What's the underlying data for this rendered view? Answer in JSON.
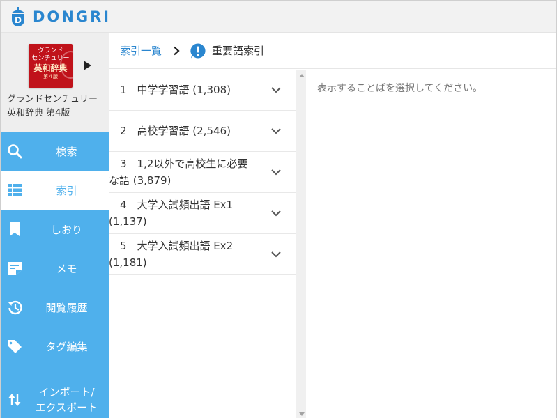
{
  "header": {
    "brand": "DONGRI",
    "logo_icon": "acorn-d-icon",
    "brand_color": "#2a86cf"
  },
  "book": {
    "cover_lines": [
      "グランド",
      "センチュリー",
      "英和辞典",
      "第４版"
    ],
    "title_line1": "グランドセンチュリー",
    "title_line2": "英和辞典 第4版",
    "cover_color": "#c0121a"
  },
  "sidebar": {
    "color": "#4fb0ec",
    "items": [
      {
        "label": "検索",
        "icon": "search-icon"
      },
      {
        "label": "索引",
        "icon": "grid-icon",
        "active": true
      },
      {
        "label": "しおり",
        "icon": "bookmark-icon"
      },
      {
        "label": "メモ",
        "icon": "note-icon"
      },
      {
        "label": "閲覧履歴",
        "icon": "history-icon"
      },
      {
        "label": "タグ編集",
        "icon": "tag-icon"
      },
      {
        "label_line1": "インポート/",
        "label_line2": "エクスポート",
        "icon": "import-export-icon"
      }
    ]
  },
  "breadcrumb": {
    "parent": "索引一覧",
    "separator_icon": "chevron-right-icon",
    "current_icon": "important-icon",
    "current": "重要語索引"
  },
  "index_list": [
    {
      "line1": "1　中学学習語 (1,308)",
      "line2": ""
    },
    {
      "line1": "2　高校学習語 (2,546)",
      "line2": ""
    },
    {
      "line1": "3　1,2以外で高校生に必要",
      "line2": "な語 (3,879)"
    },
    {
      "line1": "4　大学入試頻出語 Ex1",
      "line2": "(1,137)"
    },
    {
      "line1": "5　大学入試頻出語 Ex2",
      "line2": "(1,181)"
    }
  ],
  "content": {
    "placeholder": "表示することばを選択してください。"
  }
}
